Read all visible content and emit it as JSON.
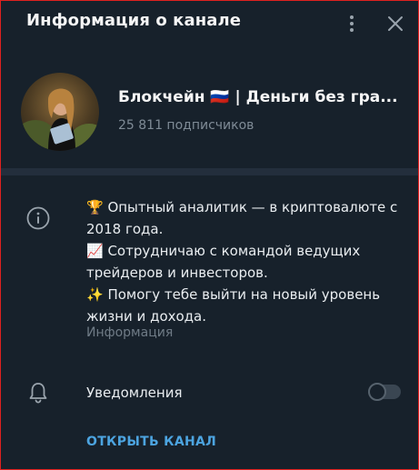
{
  "header": {
    "title": "Информация о канале",
    "menu_icon": "more-vertical-icon",
    "close_icon": "close-icon"
  },
  "channel": {
    "name": "Блокчейн 🇷🇺 | Деньги без гра...",
    "subscribers": "25 811 подписчиков"
  },
  "about": {
    "lines": [
      "🏆 Опытный аналитик — в криптовалюте с 2018 года.",
      "📈 Сотрудничаю с командой ведущих трейдеров и инвесторов.",
      "✨ Помогу тебе выйти на новый уровень жизни и дохода."
    ],
    "caption": "Информация"
  },
  "notifications": {
    "label": "Уведомления",
    "enabled": false
  },
  "actions": {
    "open_channel": "ОТКРЫТЬ КАНАЛ"
  },
  "colors": {
    "background": "#17212b",
    "accent": "#4ca4e0",
    "muted": "#7f8b96",
    "divider": "#232e3c"
  }
}
